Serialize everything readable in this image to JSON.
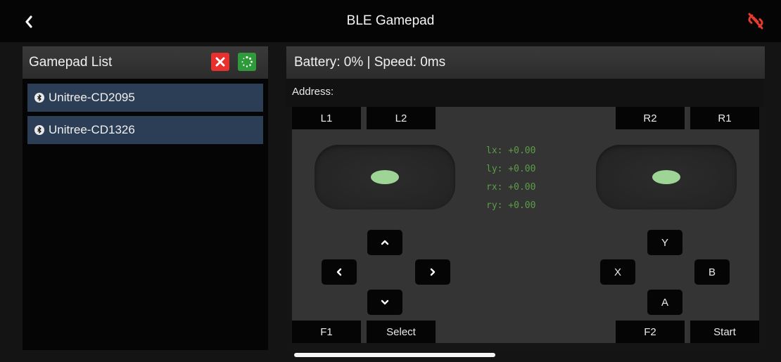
{
  "navbar": {
    "title": "BLE Gamepad",
    "back_icon": "chevron-left-icon",
    "disconnect_icon": "link-broken-icon",
    "disconnect_color": "#e83a2e"
  },
  "gamepad_list": {
    "title": "Gamepad List",
    "clear_icon": "x-icon",
    "scan_icon": "spinner-icon",
    "devices": [
      {
        "name": "Unitree-CD2095",
        "icon": "bluetooth-icon"
      },
      {
        "name": "Unitree-CD1326",
        "icon": "bluetooth-icon"
      }
    ]
  },
  "status": {
    "header": "Battery: 0% | Speed: 0ms",
    "address_label": "Address:"
  },
  "buttons": {
    "l1": "L1",
    "l2": "L2",
    "r2": "R2",
    "r1": "R1",
    "f1": "F1",
    "select": "Select",
    "f2": "F2",
    "start": "Start",
    "y": "Y",
    "x": "X",
    "b": "B",
    "a": "A"
  },
  "readout": {
    "lx": "lx: +0.00",
    "ly": "ly: +0.00",
    "rx": "rx: +0.00",
    "ry": "ry: +0.00"
  },
  "colors": {
    "stick_dot": "#9ed495",
    "readout_text": "#5b9d47",
    "device_item_bg": "#2c3e55"
  }
}
